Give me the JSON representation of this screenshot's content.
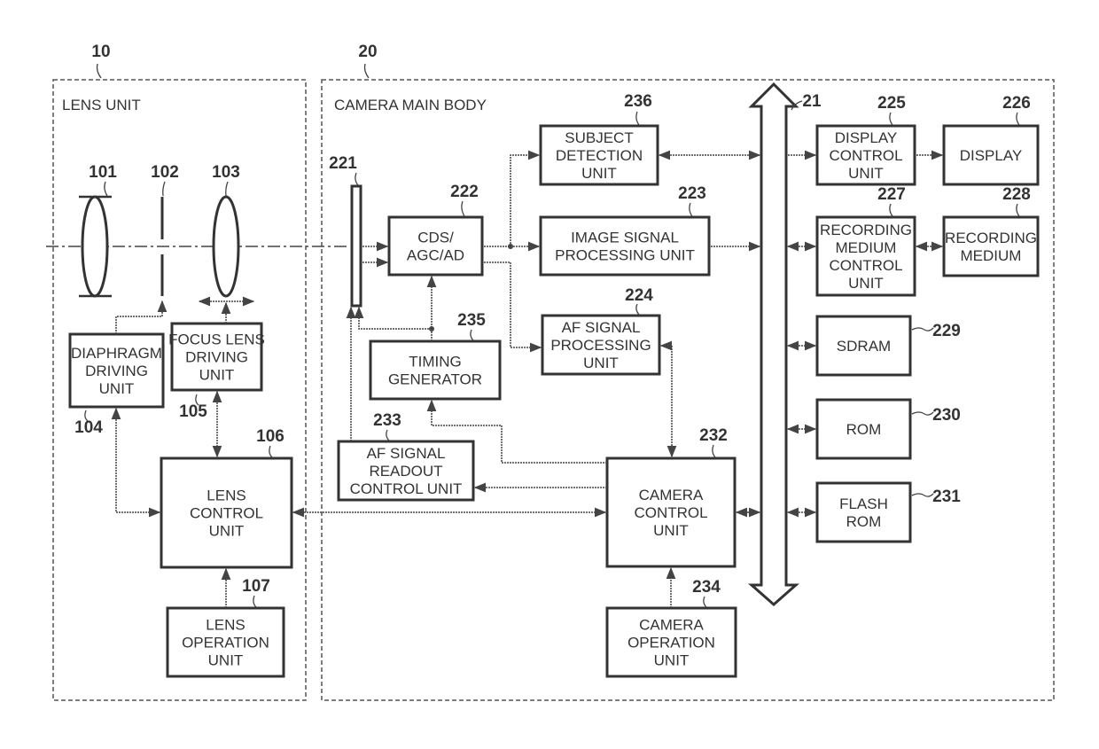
{
  "groups": {
    "lens_unit": {
      "ref": "10",
      "title": "LENS UNIT"
    },
    "camera_body": {
      "ref": "20",
      "title": "CAMERA MAIN BODY"
    }
  },
  "optics": {
    "lens_101": "101",
    "diaphragm_102": "102",
    "focus_lens_103": "103"
  },
  "bus": {
    "ref": "21"
  },
  "blocks": {
    "b104": {
      "ref": "104",
      "lines": [
        "DIAPHRAGM",
        "DRIVING",
        "UNIT"
      ]
    },
    "b105": {
      "ref": "105",
      "lines": [
        "FOCUS LENS",
        "DRIVING",
        "UNIT"
      ]
    },
    "b106": {
      "ref": "106",
      "lines": [
        "LENS",
        "CONTROL",
        "UNIT"
      ]
    },
    "b107": {
      "ref": "107",
      "lines": [
        "LENS",
        "OPERATION",
        "UNIT"
      ]
    },
    "b221": {
      "ref": "221"
    },
    "b222": {
      "ref": "222",
      "lines": [
        "CDS/",
        "AGC/AD"
      ]
    },
    "b223": {
      "ref": "223",
      "lines": [
        "IMAGE SIGNAL",
        "PROCESSING UNIT"
      ]
    },
    "b224": {
      "ref": "224",
      "lines": [
        "AF SIGNAL",
        "PROCESSING",
        "UNIT"
      ]
    },
    "b225": {
      "ref": "225",
      "lines": [
        "DISPLAY",
        "CONTROL",
        "UNIT"
      ]
    },
    "b226": {
      "ref": "226",
      "lines": [
        "DISPLAY"
      ]
    },
    "b227": {
      "ref": "227",
      "lines": [
        "RECORDING",
        "MEDIUM",
        "CONTROL",
        "UNIT"
      ]
    },
    "b228": {
      "ref": "228",
      "lines": [
        "RECORDING",
        "MEDIUM"
      ]
    },
    "b229": {
      "ref": "229",
      "lines": [
        "SDRAM"
      ]
    },
    "b230": {
      "ref": "230",
      "lines": [
        "ROM"
      ]
    },
    "b231": {
      "ref": "231",
      "lines": [
        "FLASH",
        "ROM"
      ]
    },
    "b232": {
      "ref": "232",
      "lines": [
        "CAMERA",
        "CONTROL",
        "UNIT"
      ]
    },
    "b233": {
      "ref": "233",
      "lines": [
        "AF SIGNAL",
        "READOUT",
        "CONTROL UNIT"
      ]
    },
    "b234": {
      "ref": "234",
      "lines": [
        "CAMERA",
        "OPERATION",
        "UNIT"
      ]
    },
    "b235": {
      "ref": "235",
      "lines": [
        "TIMING",
        "GENERATOR"
      ]
    },
    "b236": {
      "ref": "236",
      "lines": [
        "SUBJECT",
        "DETECTION",
        "UNIT"
      ]
    }
  }
}
